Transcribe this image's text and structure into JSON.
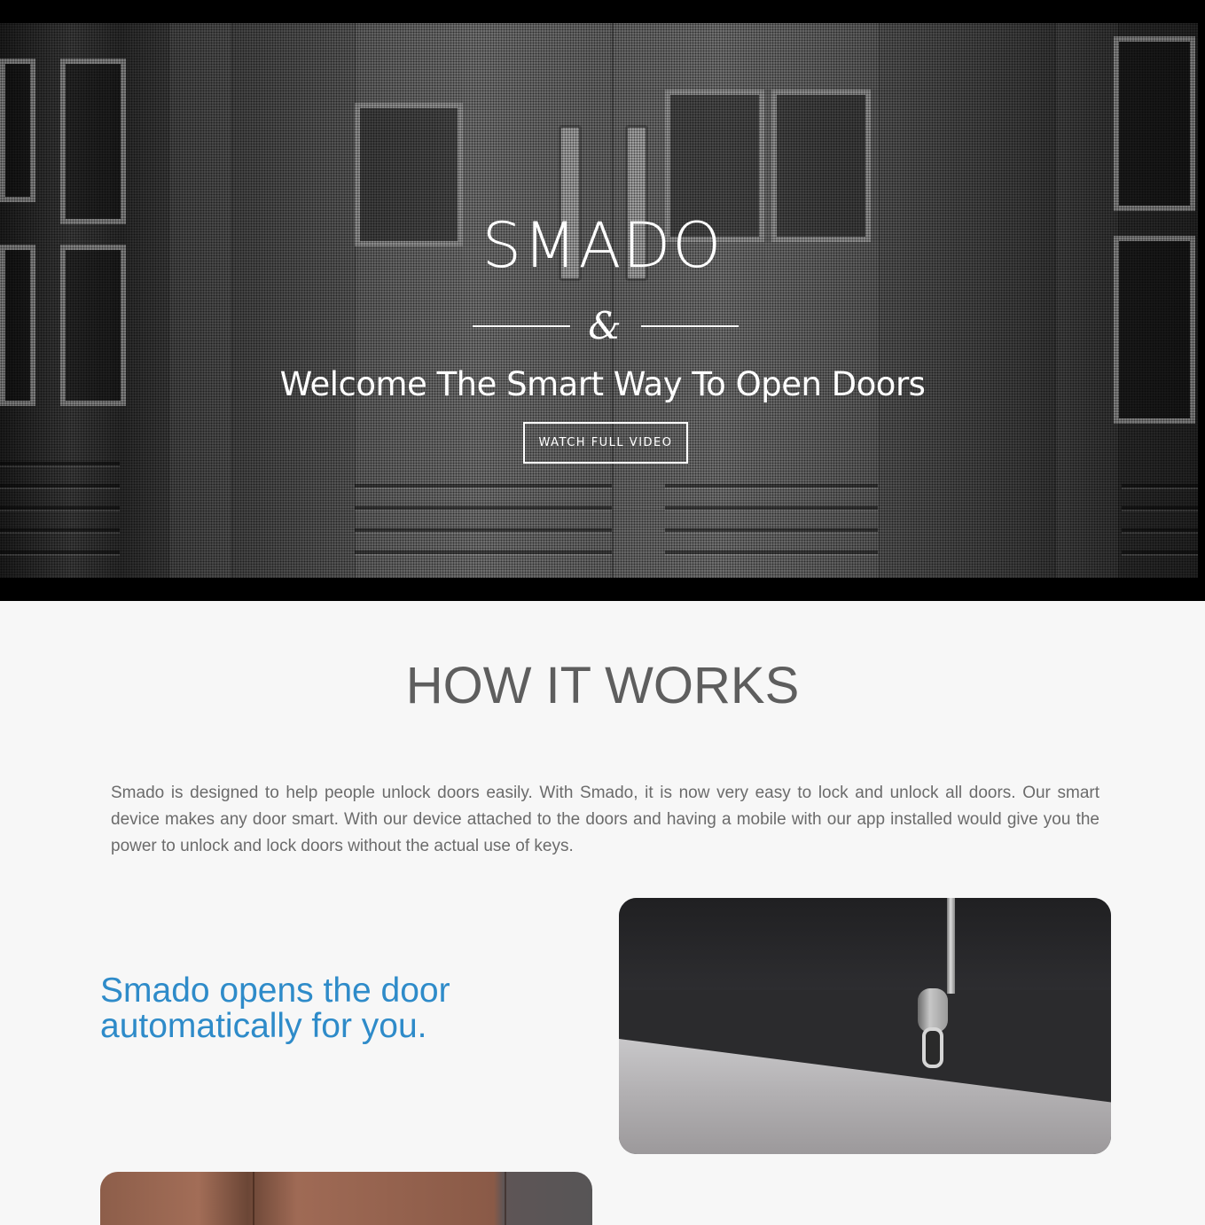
{
  "hero": {
    "title": "SMADO",
    "ampersand": "&",
    "subtitle": "Welcome The Smart Way To Open Doors",
    "button_label": "WATCH FULL VIDEO"
  },
  "how_it_works": {
    "title": "HOW IT WORKS",
    "description": "Smado is designed to help people unlock doors easily. With Smado, it is now very easy to lock and unlock all doors. Our smart device makes any door smart. With our device attached to the doors and having a mobile with our app installed would give you the power to unlock and lock doors without the actual use of keys."
  },
  "feature": {
    "heading": "Smado opens the door automatically for you."
  },
  "colors": {
    "accent": "#2e8bc9",
    "heading_gray": "#5e5e5e",
    "text_gray": "#6b6b6b",
    "page_bg": "#f7f7f7"
  }
}
